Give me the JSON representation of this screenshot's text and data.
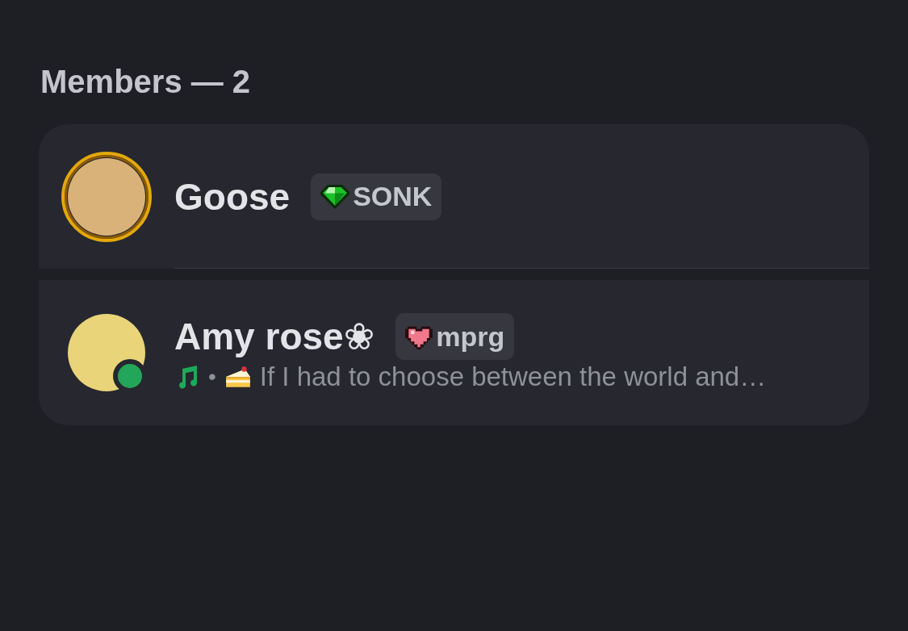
{
  "heading": "Members — 2",
  "members": [
    {
      "name": "Goose",
      "avatar_ring": true,
      "online": false,
      "tag": {
        "kind": "gem",
        "label": "SONK"
      }
    },
    {
      "name": "Amy rose❀",
      "avatar_ring": false,
      "online": true,
      "tag": {
        "kind": "heart",
        "label": "mprg"
      },
      "activity": {
        "separator": "•",
        "text": "If I had to choose between the world and…"
      }
    }
  ]
}
